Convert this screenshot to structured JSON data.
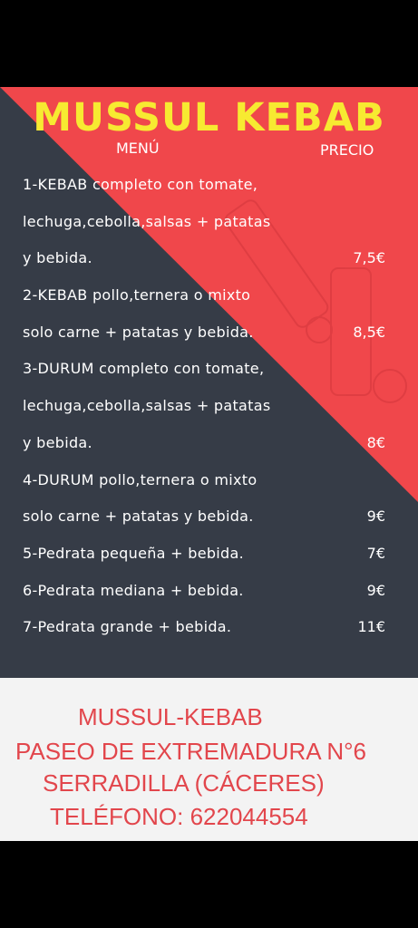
{
  "header": {
    "title": "MUSSUL KEBAB",
    "menu_label": "MENÚ",
    "price_label": "PRECIO"
  },
  "items": [
    {
      "lines": [
        "1-KEBAB completo con tomate,",
        "lechuga,cebolla,salsas + patatas",
        "y bebida."
      ],
      "price": "7,5€"
    },
    {
      "lines": [
        "2-KEBAB pollo,ternera o mixto",
        "solo carne + patatas y bebida."
      ],
      "price": "8,5€"
    },
    {
      "lines": [
        "3-DURUM completo con tomate,",
        "lechuga,cebolla,salsas + patatas",
        "y bebida."
      ],
      "price": "8€"
    },
    {
      "lines": [
        "4-DURUM pollo,ternera o mixto",
        "solo carne + patatas y bebida."
      ],
      "price": "9€"
    },
    {
      "lines": [
        "5-Pedrata pequeña + bebida."
      ],
      "price": "7€"
    },
    {
      "lines": [
        "6-Pedrata mediana + bebida."
      ],
      "price": "9€"
    },
    {
      "lines": [
        "7-Pedrata grande + bebida."
      ],
      "price": "11€"
    }
  ],
  "footer": {
    "name": "MUSSUL-KEBAB",
    "street": "PASEO DE EXTREMADURA N°6",
    "town": "SERRADILLA (CÁCERES)",
    "phone": "TELÉFONO: 622044554"
  },
  "colors": {
    "dark": "#363c47",
    "red": "#f0474b",
    "title_yellow": "#f7ea31",
    "footer_text": "#e2464c",
    "footer_bg": "#f3f3f3"
  }
}
